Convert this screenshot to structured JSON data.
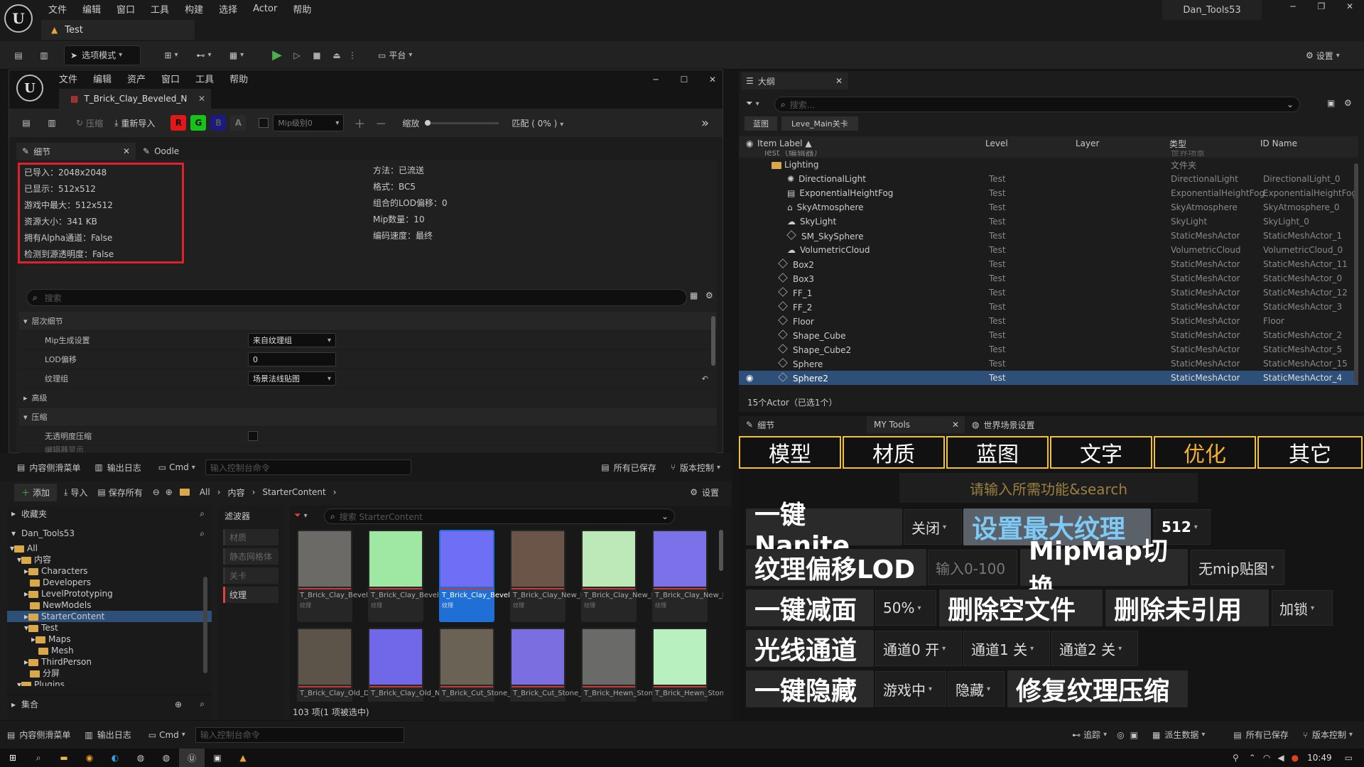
{
  "app": {
    "logo": "U",
    "menu": [
      "文件",
      "编辑",
      "窗口",
      "工具",
      "构建",
      "选择",
      "Actor",
      "帮助"
    ],
    "project": "Dan_Tools53",
    "level_tab": "Test"
  },
  "toolbar": {
    "mode": "选项模式",
    "platform": "平台",
    "settings": "设置"
  },
  "tex": {
    "menu": [
      "文件",
      "编辑",
      "资产",
      "窗口",
      "工具",
      "帮助"
    ],
    "tab": "T_Brick_Clay_Beveled_N",
    "tools": {
      "compress": "压缩",
      "reimport": "重新导入",
      "r": "R",
      "g": "G",
      "b": "B",
      "a": "A",
      "mip": "Mip级别0",
      "zoom": "缩放",
      "fit": "匹配 ( 0% )"
    },
    "details_tab": "细节",
    "oodle_tab": "Oodle",
    "info_left": [
      "已导入：2048x2048",
      "已显示：512x512",
      "游戏中最大：512x512",
      "资源大小：341 KB",
      "拥有Alpha通道：False",
      "检测到源透明度：False"
    ],
    "info_right": [
      "方法：已流送",
      "格式：BC5",
      "组合的LOD偏移：0",
      "Mip数量：10",
      "编码速度：最终"
    ],
    "search": "搜索",
    "sec_lod": "层次细节",
    "mip_gen_label": "Mip生成设置",
    "mip_gen_val": "来自纹理组",
    "lod_bias_label": "LOD偏移",
    "lod_bias_val": "0",
    "tex_group_label": "纹理组",
    "tex_group_val": "场景法线贴图",
    "advanced": "高级",
    "sec_compress": "压缩",
    "no_alpha": "无透明度压缩",
    "partial": "编辑器显示"
  },
  "outliner": {
    "title": "大纲",
    "search": "搜索...",
    "chip1": "蓝图",
    "chip2": "Leve_Main关卡",
    "cols": [
      "Item Label ▲",
      "Level",
      "Layer",
      "类型",
      "ID Name"
    ],
    "rows": [
      {
        "label": "Test（编辑器）",
        "level": "",
        "type": "世界场景",
        "id": ""
      },
      {
        "label": "Lighting",
        "level": "",
        "type": "文件夹",
        "id": ""
      },
      {
        "label": "DirectionalLight",
        "level": "Test",
        "type": "DirectionalLight",
        "id": "DirectionalLight_0"
      },
      {
        "label": "ExponentialHeightFog",
        "level": "Test",
        "type": "ExponentialHeightFog",
        "id": "ExponentialHeightFog"
      },
      {
        "label": "SkyAtmosphere",
        "level": "Test",
        "type": "SkyAtmosphere",
        "id": "SkyAtmosphere_0"
      },
      {
        "label": "SkyLight",
        "level": "Test",
        "type": "SkyLight",
        "id": "SkyLight_0"
      },
      {
        "label": "SM_SkySphere",
        "level": "Test",
        "type": "StaticMeshActor",
        "id": "StaticMeshActor_1"
      },
      {
        "label": "VolumetricCloud",
        "level": "Test",
        "type": "VolumetricCloud",
        "id": "VolumetricCloud_0"
      },
      {
        "label": "Box2",
        "level": "Test",
        "type": "StaticMeshActor",
        "id": "StaticMeshActor_11"
      },
      {
        "label": "Box3",
        "level": "Test",
        "type": "StaticMeshActor",
        "id": "StaticMeshActor_0"
      },
      {
        "label": "FF_1",
        "level": "Test",
        "type": "StaticMeshActor",
        "id": "StaticMeshActor_12"
      },
      {
        "label": "FF_2",
        "level": "Test",
        "type": "StaticMeshActor",
        "id": "StaticMeshActor_3"
      },
      {
        "label": "Floor",
        "level": "Test",
        "type": "StaticMeshActor",
        "id": "Floor"
      },
      {
        "label": "Shape_Cube",
        "level": "Test",
        "type": "StaticMeshActor",
        "id": "StaticMeshActor_2"
      },
      {
        "label": "Shape_Cube2",
        "level": "Test",
        "type": "StaticMeshActor",
        "id": "StaticMeshActor_5"
      },
      {
        "label": "Sphere",
        "level": "Test",
        "type": "StaticMeshActor",
        "id": "StaticMeshActor_15"
      },
      {
        "label": "Sphere2",
        "level": "Test",
        "type": "StaticMeshActor",
        "id": "StaticMeshActor_4"
      }
    ],
    "count": "15个Actor（已选1个）"
  },
  "mytools": {
    "tab_details": "细节",
    "tab_my": "MY Tools",
    "tab_world": "世界场景设置",
    "cats": [
      "模型",
      "材质",
      "蓝图",
      "文字",
      "优化",
      "其它"
    ],
    "search": "请输入所需功能&search",
    "nanite": "一键Nanite",
    "nanite_opt": "关闭",
    "maxtex": "设置最大纹理",
    "maxtex_opt": "512",
    "lod": "纹理偏移LOD",
    "lod_ph": "输入0-100",
    "mipmap": "MipMap切换",
    "mipmap_opt": "无mip贴图",
    "reduce": "一键减面",
    "reduce_opt": "50%",
    "del_empty": "删除空文件",
    "del_unref": "删除未引用",
    "lock_opt": "加锁",
    "light": "光线通道",
    "ch0": "通道0 开",
    "ch1": "通道1 关",
    "ch2": "通道2 关",
    "hide": "一键隐藏",
    "hide_opt1": "游戏中",
    "hide_opt2": "隐藏",
    "fix": "修复纹理压缩"
  },
  "cb": {
    "drawer": "内容侧滑菜单",
    "log": "输出日志",
    "cmd": "Cmd",
    "cmd_ph": "输入控制台命令",
    "saved": "所有已保存",
    "vc": "版本控制",
    "add": "添加",
    "import": "导入",
    "saveall": "保存所有",
    "crumbs": [
      "All",
      "内容",
      "StarterContent"
    ],
    "settings": "设置",
    "fav": "收藏夹",
    "project": "Dan_Tools53",
    "tree": [
      "All",
      "内容",
      "Characters",
      "Developers",
      "LevelPrototyping",
      "NewModels",
      "StarterContent",
      "Test",
      "Maps",
      "Mesh",
      "ThirdPerson",
      "分屏",
      "Plugins"
    ],
    "collections": "集合",
    "filters": "滤波器",
    "filter_items": [
      "材质",
      "静态网格体",
      "关卡",
      "纹理"
    ],
    "search": "搜索 StarterContent",
    "assets": [
      {
        "name": "T_Brick_Clay_Beveled_D",
        "sub": "纹理",
        "color": "#6b6a66"
      },
      {
        "name": "T_Brick_Clay_Beveled_M",
        "sub": "纹理",
        "color": "#9fe8a4"
      },
      {
        "name": "T_Brick_Clay_Beveled_N",
        "sub": "纹理",
        "color": "#6f6ff5"
      },
      {
        "name": "T_Brick_Clay_New_D",
        "sub": "纹理",
        "color": "#6a5548"
      },
      {
        "name": "T_Brick_Clay_New_M",
        "sub": "纹理",
        "color": "#bde9b9"
      },
      {
        "name": "T_Brick_Clay_New_N",
        "sub": "纹理",
        "color": "#7b72ea"
      },
      {
        "name": "T_Brick_Clay_Old_D",
        "sub": "",
        "color": "#5c5448"
      },
      {
        "name": "T_Brick_Clay_Old_N",
        "sub": "",
        "color": "#7068e8"
      },
      {
        "name": "T_Brick_Cut_Stone_D",
        "sub": "",
        "color": "#6b6256"
      },
      {
        "name": "T_Brick_Cut_Stone_N",
        "sub": "",
        "color": "#7a6ee0"
      },
      {
        "name": "T_Brick_Hewn_Stone_D",
        "sub": "",
        "color": "#6a6a68"
      },
      {
        "name": "T_Brick_Hewn_Stone_M",
        "sub": "",
        "color": "#b9f0c0"
      }
    ],
    "count": "103 项(1 项被选中)"
  },
  "status": {
    "drawer": "内容侧滑菜单",
    "log": "输出日志",
    "cmd": "Cmd",
    "cmd_ph": "输入控制台命令",
    "trace": "追踪",
    "derived": "派生数据",
    "saved": "所有已保存",
    "vc": "版本控制"
  },
  "taskbar": {
    "time": "10:49"
  }
}
